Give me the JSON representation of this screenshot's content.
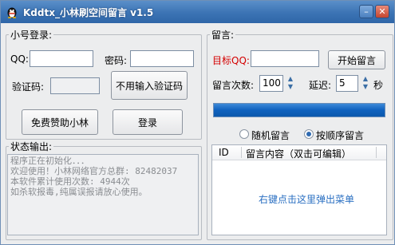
{
  "window": {
    "title": "Kddtx_小林刷空间留言 v1.5",
    "controls": {
      "minimize": "–",
      "close": "✕"
    }
  },
  "login": {
    "legend": "小号登录:",
    "qq_label": "QQ:",
    "qq_value": "",
    "password_label": "密码:",
    "password_value": "",
    "captcha_label": "验证码:",
    "captcha_value": "",
    "no_captcha_button": "不用输入验证码",
    "donate_button": "免费赞助小林",
    "login_button": "登录"
  },
  "message": {
    "legend": "留言:",
    "target_label": "目标QQ:",
    "target_value": "",
    "start_button": "开始留言",
    "count_label": "留言次数:",
    "count_value": "100",
    "delay_label": "延迟:",
    "delay_value": "5",
    "delay_unit": "秒",
    "progress": 1.0,
    "radio_random": "随机留言",
    "radio_ordered": "按顺序留言",
    "selected_mode": "ordered",
    "list_columns": [
      "ID",
      "留言内容（双击可编辑）"
    ],
    "list_hint": "右键点击这里弹出菜单"
  },
  "status": {
    "legend": "状态输出:",
    "lines": [
      "程序正在初始化．．．",
      "欢迎使用！小林网络官方总群: 82482037",
      "本软件累计使用次数: 4944次",
      "如杀软报毒,纯属误报请放心使用。"
    ]
  },
  "colors": {
    "titlebar": "#3b73b4",
    "target_label": "#d40000",
    "progress": "#0f62be",
    "hint": "#2a6fc2"
  }
}
